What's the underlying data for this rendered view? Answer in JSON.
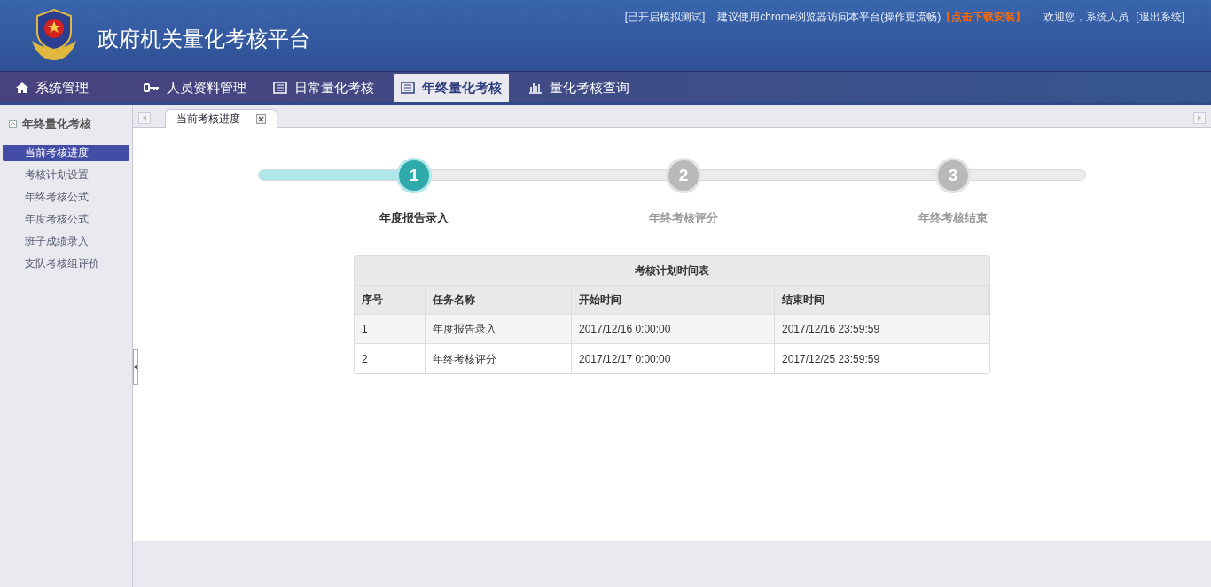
{
  "header": {
    "title": "政府机关量化考核平台",
    "notice": "[已开启模拟测试]",
    "tip": "建议使用chrome浏览器访问本平台(操作更流畅)",
    "download_link": "【点击下载安装】",
    "welcome": "欢迎您，系统人员",
    "logout": "[退出系统]"
  },
  "nav": [
    {
      "label": "系统管理",
      "kind": "home",
      "selected": false
    },
    {
      "label": "人员资料管理",
      "kind": "key",
      "selected": false
    },
    {
      "label": "日常量化考核",
      "kind": "list",
      "selected": false
    },
    {
      "label": "年终量化考核",
      "kind": "list",
      "selected": true
    },
    {
      "label": "量化考核查询",
      "kind": "chart",
      "selected": false
    }
  ],
  "sidebar": {
    "title": "年终量化考核",
    "items": [
      {
        "label": "当前考核进度",
        "selected": true
      },
      {
        "label": "考核计划设置",
        "selected": false
      },
      {
        "label": "年终考核公式",
        "selected": false
      },
      {
        "label": "年度考核公式",
        "selected": false
      },
      {
        "label": "班子成绩录入",
        "selected": false
      },
      {
        "label": "支队考核组评价",
        "selected": false
      }
    ]
  },
  "page_tabs": [
    {
      "label": "当前考核进度",
      "selected": true
    }
  ],
  "progress": {
    "level": 0.19,
    "steps": [
      {
        "number": "1",
        "label": "年度报告录入",
        "selected": true
      },
      {
        "number": "2",
        "label": "年终考核评分",
        "selected": false
      },
      {
        "number": "3",
        "label": "年终考核结束",
        "selected": false
      }
    ]
  },
  "table": {
    "caption": "考核计划时间表",
    "columns": [
      "序号",
      "任务名称",
      "开始时间",
      "结束时间"
    ],
    "rows": [
      [
        "1",
        "年度报告录入",
        "2017/12/16 0:00:00",
        "2017/12/16 23:59:59"
      ],
      [
        "2",
        "年终考核评分",
        "2017/12/17 0:00:00",
        "2017/12/25 23:59:59"
      ]
    ]
  }
}
